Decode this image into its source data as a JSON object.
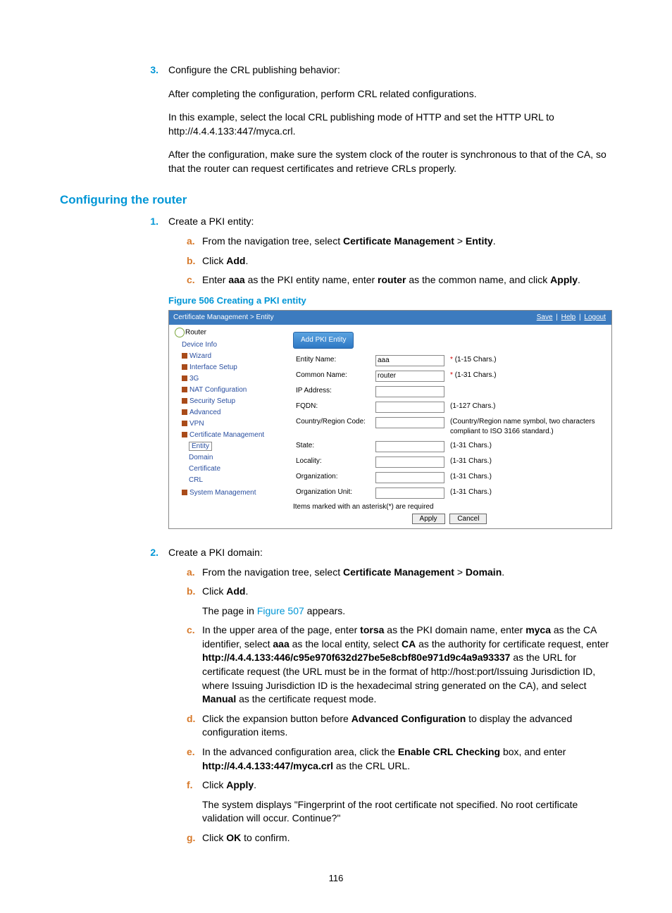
{
  "step3": {
    "num": "3.",
    "title": "Configure the CRL publishing behavior:",
    "p1": "After completing the configuration, perform CRL related configurations.",
    "p2a": "In this example, select the local CRL publishing mode of HTTP and set the HTTP URL to ",
    "p2b": "http://4.4.4.133:447/myca.crl.",
    "p3": "After the configuration, make sure the system clock of the router is synchronous to that of the CA, so that the router can request certificates and retrieve CRLs properly."
  },
  "sectionHeading": "Configuring the router",
  "r1": {
    "num": "1.",
    "title": "Create a PKI entity:",
    "a": {
      "l": "a.",
      "pre": "From the navigation tree, select ",
      "b1": "Certificate Management",
      "mid": " > ",
      "b2": "Entity",
      "post": "."
    },
    "b": {
      "l": "b.",
      "pre": "Click ",
      "b1": "Add",
      "post": "."
    },
    "c": {
      "l": "c.",
      "pre": "Enter ",
      "b1": "aaa",
      "mid1": " as the PKI entity name, enter ",
      "b2": "router",
      "mid2": " as the common name, and click ",
      "b3": "Apply",
      "post": "."
    },
    "figCaption": "Figure 506 Creating a PKI entity"
  },
  "fig": {
    "breadcrumb": "Certificate Management > Entity",
    "links": {
      "save": "Save",
      "help": "Help",
      "logout": "Logout"
    },
    "rootLabel": "Router",
    "nav": [
      "Device Info",
      "Wizard",
      "Interface Setup",
      "3G",
      "NAT Configuration",
      "Security Setup",
      "Advanced",
      "VPN",
      "Certificate Management"
    ],
    "certSub": [
      "Entity",
      "Domain",
      "Certificate",
      "CRL"
    ],
    "navLast": "System Management",
    "tab": "Add PKI Entity",
    "rows": {
      "entityName": {
        "label": "Entity Name:",
        "val": "aaa",
        "hint": "(1-15 Chars.)",
        "req": "*"
      },
      "commonName": {
        "label": "Common Name:",
        "val": "router",
        "hint": "(1-31 Chars.)",
        "req": "*"
      },
      "ip": {
        "label": "IP Address:",
        "val": "",
        "hint": ""
      },
      "fqdn": {
        "label": "FQDN:",
        "val": "",
        "hint": "(1-127 Chars.)"
      },
      "country": {
        "label": "Country/Region Code:",
        "val": "",
        "hint": "(Country/Region name symbol, two characters compliant to ISO 3166 standard.)"
      },
      "state": {
        "label": "State:",
        "val": "",
        "hint": "(1-31 Chars.)"
      },
      "locality": {
        "label": "Locality:",
        "val": "",
        "hint": "(1-31 Chars.)"
      },
      "org": {
        "label": "Organization:",
        "val": "",
        "hint": "(1-31 Chars.)"
      },
      "orgUnit": {
        "label": "Organization Unit:",
        "val": "",
        "hint": "(1-31 Chars.)"
      }
    },
    "footerNote": "Items marked with an asterisk(*) are required",
    "btnApply": "Apply",
    "btnCancel": "Cancel"
  },
  "r2": {
    "num": "2.",
    "title": "Create a PKI domain:",
    "a": {
      "l": "a.",
      "pre": "From the navigation tree, select ",
      "b1": "Certificate Management",
      "mid": " > ",
      "b2": "Domain",
      "post": "."
    },
    "b": {
      "l": "b.",
      "pre": "Click ",
      "b1": "Add",
      "post": ".",
      "extraPre": "The page in ",
      "extraLink": "Figure 507",
      "extraPost": " appears."
    },
    "c": {
      "l": "c.",
      "t1": "In the upper area of the page, enter ",
      "b1": "torsa",
      "t2": " as the PKI domain name, enter ",
      "b2": "myca",
      "t3": " as the CA identifier, select ",
      "b3": "aaa",
      "t4": " as the local entity, select ",
      "b4": "CA",
      "t5": " as the authority for certificate request, enter ",
      "b5": "http://4.4.4.133:446/c95e970f632d27be5e8cbf80e971d9c4a9a93337",
      "t6": " as the URL for certificate request (the URL must be in the format of http://host:port/Issuing Jurisdiction ID, where Issuing Jurisdiction ID is the hexadecimal string generated on the CA), and select ",
      "b6": "Manual",
      "t7": " as the certificate request mode."
    },
    "d": {
      "l": "d.",
      "t1": "Click the expansion button before ",
      "b1": "Advanced Configuration",
      "t2": " to display the advanced configuration items."
    },
    "e": {
      "l": "e.",
      "t1": "In the advanced configuration area, click the ",
      "b1": "Enable CRL Checking",
      "t2": " box, and enter ",
      "b2": "http://4.4.4.133:447/myca.crl",
      "t3": " as the CRL URL."
    },
    "f": {
      "l": "f.",
      "t1": "Click ",
      "b1": "Apply",
      "t2": ".",
      "extra": "The system displays \"Fingerprint of the root certificate not specified. No root certificate validation will occur. Continue?\""
    },
    "g": {
      "l": "g.",
      "t1": "Click ",
      "b1": "OK",
      "t2": " to confirm."
    }
  },
  "pageNumber": "116"
}
